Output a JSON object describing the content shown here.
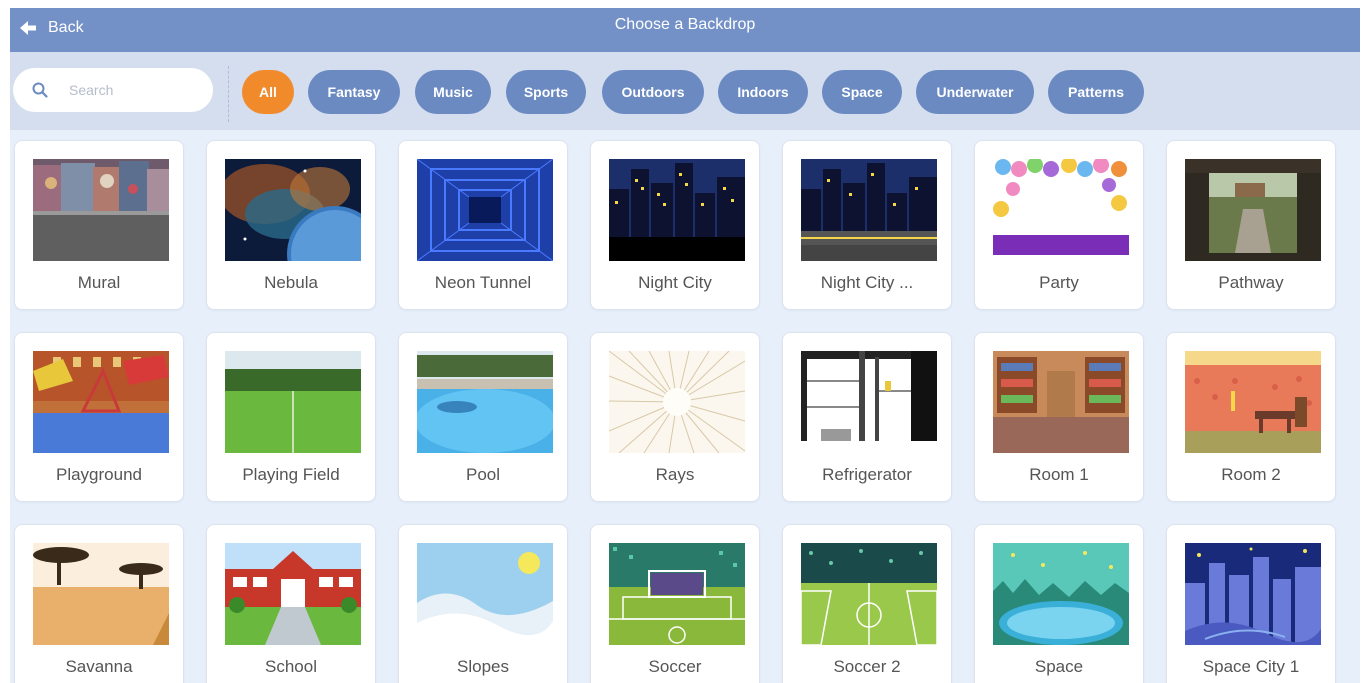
{
  "header": {
    "back_label": "Back",
    "title": "Choose a Backdrop"
  },
  "search": {
    "placeholder": "Search"
  },
  "filters": [
    "All",
    "Fantasy",
    "Music",
    "Sports",
    "Outdoors",
    "Indoors",
    "Space",
    "Underwater",
    "Patterns"
  ],
  "active_filter": "All",
  "colors": {
    "header": "#7391c7",
    "filter_bar": "#d4deee",
    "chip": "#6b8ac2",
    "chip_active": "#f18a2b",
    "background": "#e6effa"
  },
  "backdrops": [
    {
      "name": "Mural"
    },
    {
      "name": "Nebula"
    },
    {
      "name": "Neon Tunnel"
    },
    {
      "name": "Night City"
    },
    {
      "name": "Night City ..."
    },
    {
      "name": "Party"
    },
    {
      "name": "Pathway"
    },
    {
      "name": "Playground"
    },
    {
      "name": "Playing Field"
    },
    {
      "name": "Pool"
    },
    {
      "name": "Rays"
    },
    {
      "name": "Refrigerator"
    },
    {
      "name": "Room 1"
    },
    {
      "name": "Room 2"
    },
    {
      "name": "Savanna"
    },
    {
      "name": "School"
    },
    {
      "name": "Slopes"
    },
    {
      "name": "Soccer"
    },
    {
      "name": "Soccer 2"
    },
    {
      "name": "Space"
    },
    {
      "name": "Space City 1"
    }
  ]
}
